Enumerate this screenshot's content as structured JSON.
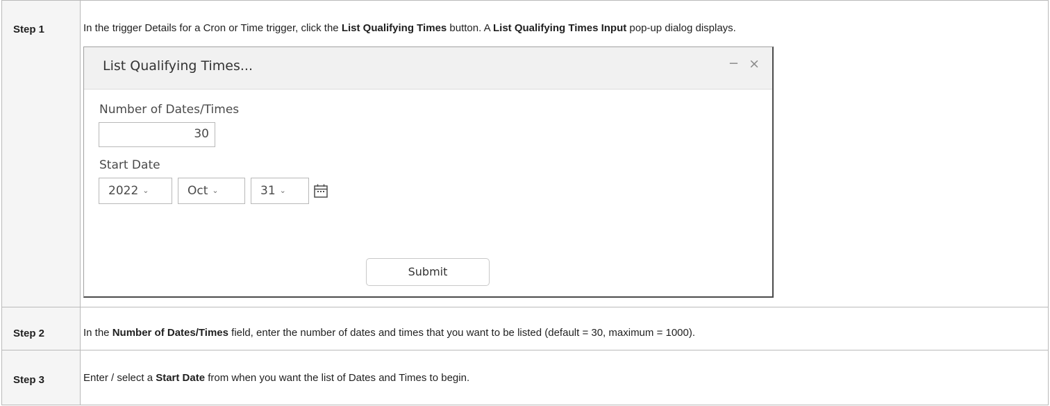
{
  "steps": [
    {
      "label": "Step 1",
      "text_parts": [
        "In the trigger Details for a Cron or Time trigger, click the ",
        "List Qualifying Times",
        " button. A ",
        "List Qualifying Times Input",
        " pop-up dialog displays."
      ]
    },
    {
      "label": "Step 2",
      "text_parts": [
        "In the ",
        "Number of Dates/Times",
        " field, enter the number of dates and times that you want to be listed (default = 30, maximum = 1000)."
      ]
    },
    {
      "label": "Step 3",
      "text_parts": [
        "Enter / select a ",
        "Start Date",
        " from when you want the list of Dates and Times to begin."
      ]
    }
  ],
  "dialog": {
    "title": "List Qualifying Times...",
    "minimize_glyph": "−",
    "close_glyph": "×",
    "number_label": "Number of Dates/Times",
    "number_value": "30",
    "start_date_label": "Start Date",
    "year": "2022",
    "month": "Oct",
    "day": "31",
    "chevron_glyph": "⌄",
    "calendar_icon": "calendar-icon",
    "submit_label": "Submit"
  }
}
